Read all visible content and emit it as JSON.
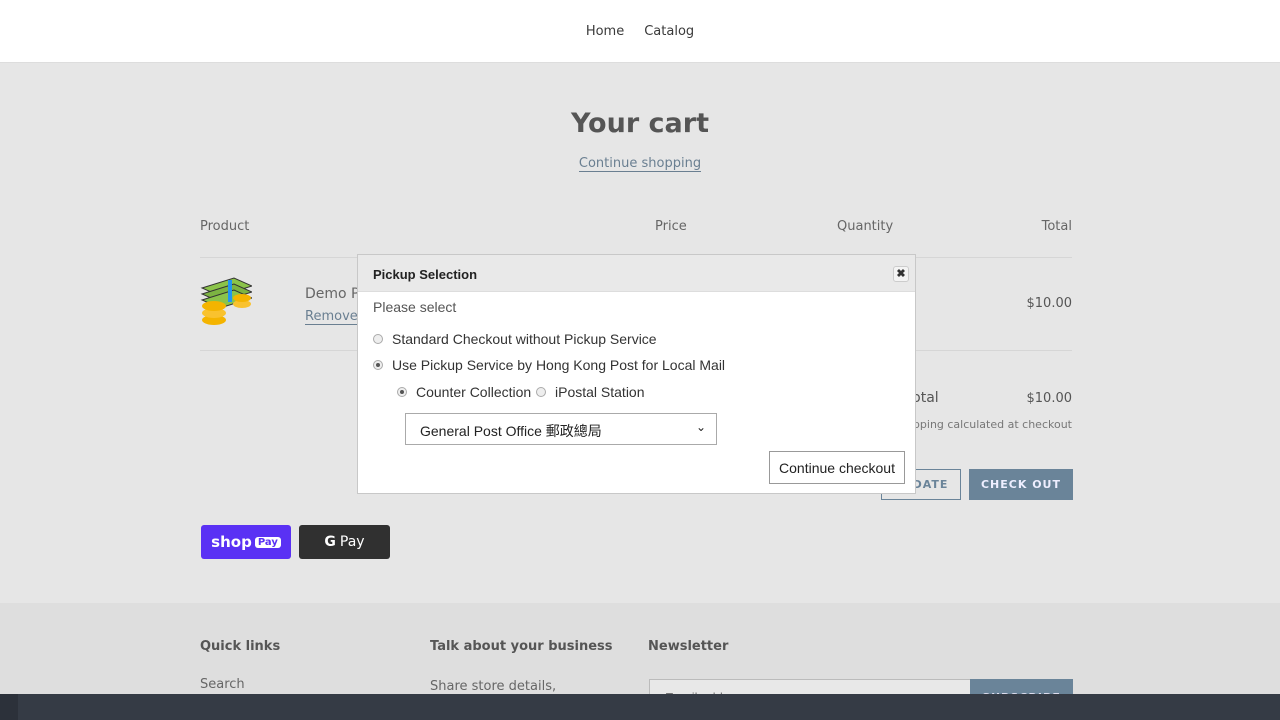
{
  "nav": {
    "items": [
      "Home",
      "Catalog"
    ]
  },
  "cart": {
    "title": "Your cart",
    "continue": "Continue shopping",
    "headers": {
      "product": "Product",
      "price": "Price",
      "quantity": "Quantity",
      "total": "Total"
    },
    "item": {
      "name": "Demo Product",
      "remove": "Remove",
      "total": "$10.00"
    },
    "subtotal_label": "Subtotal",
    "subtotal": "$10.00",
    "shipping_note": "Shipping calculated at checkout",
    "update": "UPDATE",
    "checkout": "CHECK OUT",
    "shop_pay": "shop",
    "shop_pay_badge": "Pay",
    "google_pay": "Pay"
  },
  "footer": {
    "quick_links": "Quick links",
    "search": "Search",
    "business_title": "Talk about your business",
    "business_text": "Share store details, promotions, or brand content",
    "newsletter": "Newsletter",
    "email_placeholder": "Email address",
    "subscribe": "SUBSCRIBE"
  },
  "modal": {
    "title": "Pickup Selection",
    "prompt": "Please select",
    "options": [
      "Standard Checkout without Pickup Service",
      "Use Pickup Service by Hong Kong Post for Local Mail"
    ],
    "sub_options": [
      "Counter Collection",
      "iPostal Station"
    ],
    "selected_office": "General Post Office 郵政總局",
    "continue": "Continue checkout"
  },
  "colors": {
    "accent": "#6a8499",
    "shop_pay": "#5a31f4",
    "google_pay": "#303030",
    "cookie_bar": "#353b45"
  }
}
